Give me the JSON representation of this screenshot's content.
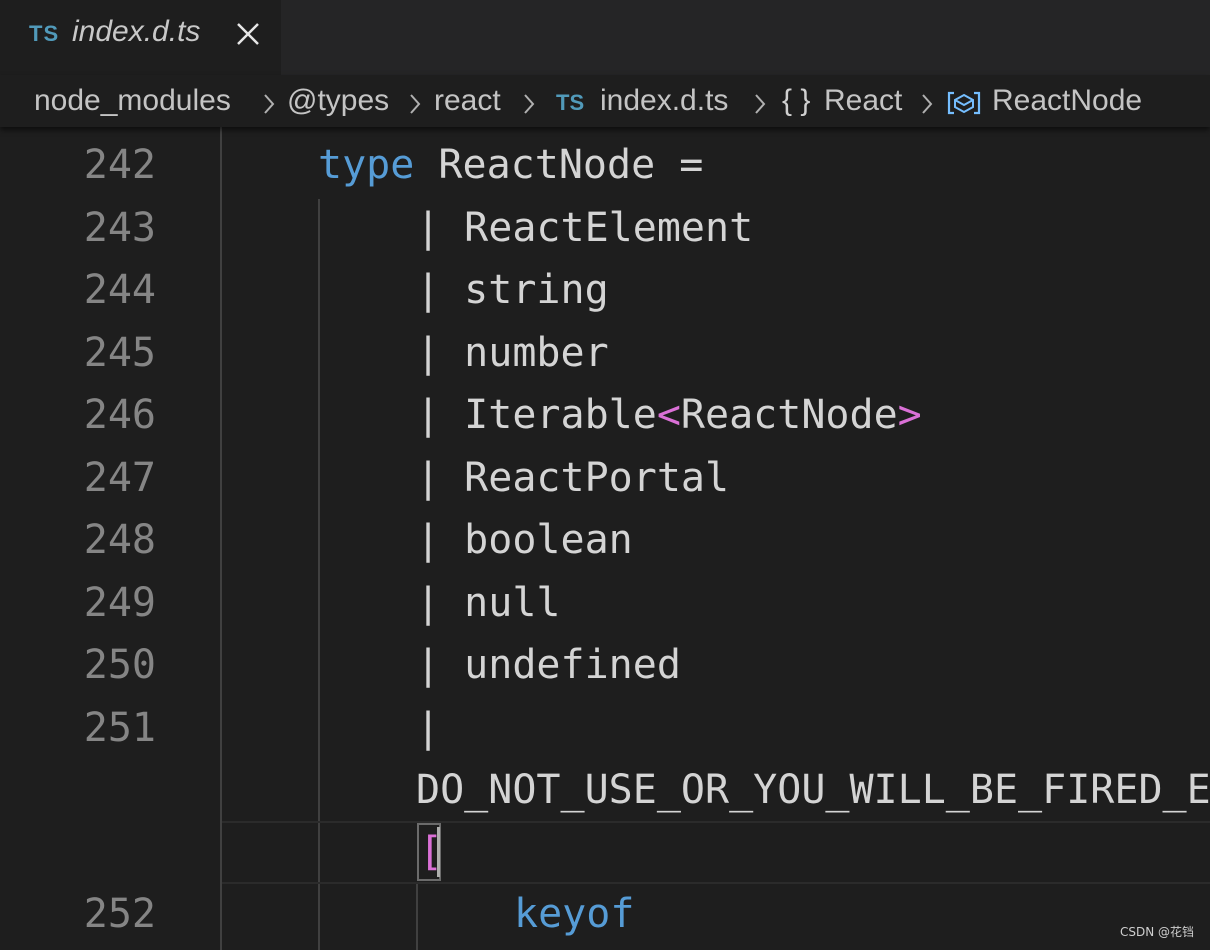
{
  "tab": {
    "lang_badge": "TS",
    "filename": "index.d.ts"
  },
  "breadcrumb": {
    "segments": [
      "node_modules",
      "@types",
      "react",
      "index.d.ts",
      "React",
      "ReactNode"
    ],
    "file_badge": "TS",
    "namespace_icon": "{ }"
  },
  "editor": {
    "line_numbers": [
      "242",
      "243",
      "244",
      "245",
      "246",
      "247",
      "248",
      "249",
      "250",
      "251",
      "252"
    ],
    "lines": {
      "l242_keyword": "type",
      "l242_rest": " ReactNode =",
      "l243": "| ReactElement",
      "l244": "| string",
      "l245": "| number",
      "l246_pre": "| Iterable",
      "l246_open": "<",
      "l246_mid": "ReactNode",
      "l246_close": ">",
      "l247": "| ReactPortal",
      "l248": "| boolean",
      "l249": "| null",
      "l250": "| undefined",
      "l251": "|",
      "l251_wrap": "DO_NOT_USE_OR_YOU_WILL_BE_FIRED_E",
      "l251_bracket": "[",
      "l252_keyword": "keyof"
    }
  },
  "watermark": "CSDN @花铛",
  "colors": {
    "keyword": "#569cd6",
    "bracket": "#da70d6",
    "ts_badge": "#519aba",
    "text": "#d4d4d4",
    "line_number": "#858585"
  }
}
